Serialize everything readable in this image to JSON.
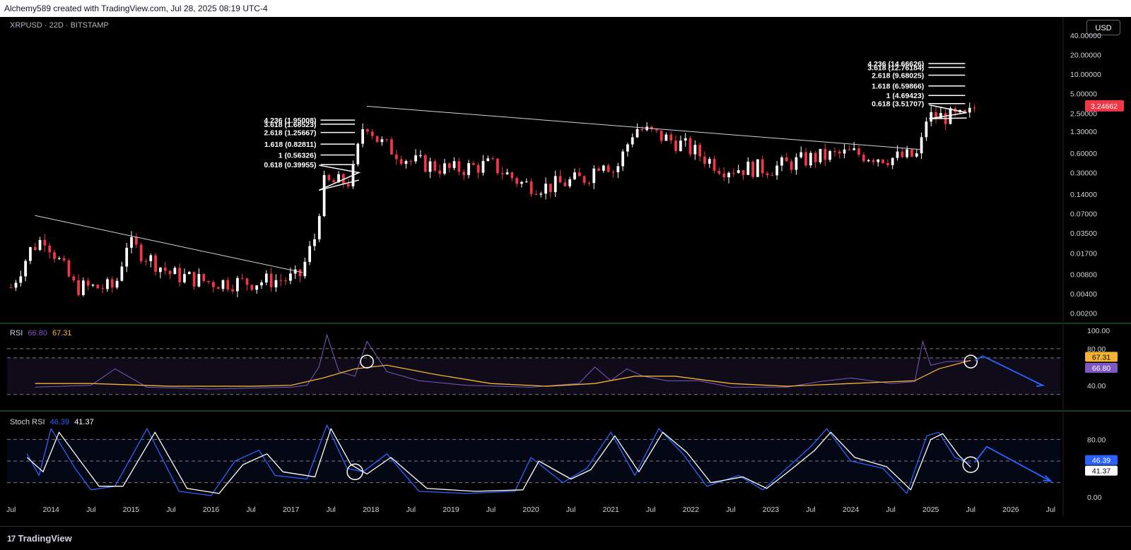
{
  "header": {
    "attribution": "Alchemy589 created with TradingView.com, Jul 28, 2025 08:19 UTC-4"
  },
  "symbol_line": "XRPUSD · 22D · BITSTAMP",
  "currency_button": "USD",
  "footer": {
    "brand": "TradingView",
    "brand_mark": "17"
  },
  "colors": {
    "up": "#ffffff",
    "down": "#f23645",
    "rsi": "#7e57c2",
    "rsi_ma": "#f5b335",
    "stoch_k": "#2962ff",
    "stoch_d": "#ffffff",
    "arrow": "#2962ff",
    "pane_border": "#2e7d32"
  },
  "chart_data": [
    {
      "type": "candlestick",
      "pane": "price",
      "scale": "log",
      "y_ticks": [
        "40.00000",
        "20.00000",
        "10.00000",
        "5.00000",
        "2.50000",
        "1.30000",
        "0.60000",
        "0.30000",
        "0.14000",
        "0.07000",
        "0.03500",
        "0.01700",
        "0.00800",
        "0.00400",
        "0.00200"
      ],
      "x_ticks": [
        "Jul",
        "2014",
        "Jul",
        "2015",
        "Jul",
        "2016",
        "Jul",
        "2017",
        "Jul",
        "2018",
        "Jul",
        "2019",
        "Jul",
        "2020",
        "Jul",
        "2021",
        "Jul",
        "2022",
        "Jul",
        "2023",
        "Jul",
        "2024",
        "Jul",
        "2025",
        "Jul",
        "2026",
        "Jul"
      ],
      "last_price": "3.24662",
      "ohlc_anchors": [
        {
          "t": 2013.5,
          "close": 0.005
        },
        {
          "t": 2013.75,
          "close": 0.02
        },
        {
          "t": 2013.92,
          "close": 0.03
        },
        {
          "t": 2014.3,
          "close": 0.005
        },
        {
          "t": 2014.8,
          "close": 0.005
        },
        {
          "t": 2014.95,
          "close": 0.025
        },
        {
          "t": 2015.5,
          "close": 0.008
        },
        {
          "t": 2016.0,
          "close": 0.006
        },
        {
          "t": 2016.5,
          "close": 0.006
        },
        {
          "t": 2017.1,
          "close": 0.007
        },
        {
          "t": 2017.3,
          "close": 0.03
        },
        {
          "t": 2017.4,
          "close": 0.2
        },
        {
          "t": 2017.75,
          "close": 0.22
        },
        {
          "t": 2017.92,
          "close": 2.0
        },
        {
          "t": 2018.1,
          "close": 0.9
        },
        {
          "t": 2018.5,
          "close": 0.45
        },
        {
          "t": 2019.0,
          "close": 0.33
        },
        {
          "t": 2019.5,
          "close": 0.4
        },
        {
          "t": 2019.9,
          "close": 0.2
        },
        {
          "t": 2020.2,
          "close": 0.18
        },
        {
          "t": 2020.7,
          "close": 0.25
        },
        {
          "t": 2020.9,
          "close": 0.5
        },
        {
          "t": 2021.05,
          "close": 0.3
        },
        {
          "t": 2021.3,
          "close": 1.5
        },
        {
          "t": 2021.7,
          "close": 1.0
        },
        {
          "t": 2021.9,
          "close": 0.8
        },
        {
          "t": 2022.4,
          "close": 0.35
        },
        {
          "t": 2023.0,
          "close": 0.35
        },
        {
          "t": 2023.5,
          "close": 0.5
        },
        {
          "t": 2024.0,
          "close": 0.6
        },
        {
          "t": 2024.5,
          "close": 0.5
        },
        {
          "t": 2024.85,
          "close": 0.55
        },
        {
          "t": 2024.95,
          "close": 2.2
        },
        {
          "t": 2025.2,
          "close": 2.2
        },
        {
          "t": 2025.45,
          "close": 2.1
        },
        {
          "t": 2025.56,
          "close": 3.24662
        }
      ],
      "fib_groups": [
        {
          "levels": [
            "4.236 (1.95008)",
            "3.618 (1.68523)",
            "2.618 (1.25667)",
            "1.618 (0.82811)",
            "1 (0.56326)",
            "0.618 (0.39955)"
          ]
        },
        {
          "levels": [
            "4.236 (14.66626)",
            "3.618 (12.76184)",
            "2.618 (9.68025)",
            "1.618 (6.59866)",
            "1 (4.69423)",
            "0.618 (3.51707)"
          ]
        }
      ]
    },
    {
      "type": "line",
      "pane": "RSI",
      "title": "RSI",
      "values_shown": [
        "66.80",
        "67.31"
      ],
      "y_ticks": [
        "100.00",
        "80.00",
        "60.00",
        "40.00"
      ],
      "bands": [
        80,
        70,
        30
      ],
      "series": [
        {
          "name": "RSI",
          "color": "#7e57c2",
          "x": [
            2013.8,
            2014.5,
            2014.8,
            2015.2,
            2016.0,
            2017.0,
            2017.2,
            2017.35,
            2017.45,
            2017.6,
            2017.8,
            2017.95,
            2018.2,
            2018.6,
            2019.2,
            2020.0,
            2020.6,
            2020.8,
            2021.0,
            2021.2,
            2021.4,
            2021.7,
            2022.1,
            2022.5,
            2023.2,
            2023.6,
            2024.0,
            2024.5,
            2024.8,
            2024.9,
            2025.0,
            2025.2,
            2025.5
          ],
          "y": [
            38,
            40,
            58,
            38,
            36,
            38,
            40,
            60,
            95,
            55,
            50,
            88,
            55,
            45,
            40,
            38,
            42,
            60,
            45,
            58,
            50,
            45,
            45,
            38,
            38,
            44,
            48,
            42,
            44,
            88,
            62,
            66,
            66.8
          ]
        },
        {
          "name": "RSI MA",
          "color": "#f5b335",
          "x": [
            2013.8,
            2014.5,
            2015.5,
            2016.5,
            2017.0,
            2017.4,
            2017.8,
            2018.2,
            2018.8,
            2019.5,
            2020.2,
            2020.8,
            2021.3,
            2021.8,
            2022.5,
            2023.2,
            2024.0,
            2024.8,
            2025.1,
            2025.5
          ],
          "y": [
            42,
            42,
            39,
            39,
            40,
            48,
            58,
            62,
            52,
            42,
            39,
            42,
            50,
            50,
            42,
            39,
            42,
            45,
            58,
            67.31
          ]
        }
      ]
    },
    {
      "type": "line",
      "pane": "Stoch RSI",
      "title": "Stoch RSI",
      "values_shown": [
        "46.39",
        "41.37"
      ],
      "y_ticks": [
        "80.00",
        "0.00"
      ],
      "bands": [
        80,
        50,
        20
      ],
      "series": [
        {
          "name": "K",
          "color": "#2962ff",
          "x": [
            2013.7,
            2013.85,
            2014.0,
            2014.3,
            2014.5,
            2014.8,
            2015.2,
            2015.6,
            2016.0,
            2016.3,
            2016.6,
            2016.8,
            2017.2,
            2017.45,
            2017.7,
            2017.9,
            2018.2,
            2018.6,
            2019.2,
            2019.8,
            2020.0,
            2020.4,
            2020.7,
            2021.0,
            2021.3,
            2021.6,
            2021.9,
            2022.2,
            2022.6,
            2022.9,
            2023.2,
            2023.5,
            2023.7,
            2024.0,
            2024.4,
            2024.7,
            2024.95,
            2025.1,
            2025.3,
            2025.5
          ],
          "y": [
            60,
            30,
            95,
            40,
            10,
            15,
            95,
            8,
            2,
            50,
            65,
            30,
            25,
            100,
            40,
            35,
            60,
            8,
            5,
            8,
            55,
            20,
            40,
            90,
            30,
            95,
            60,
            15,
            30,
            10,
            40,
            70,
            95,
            50,
            40,
            5,
            85,
            90,
            55,
            46.39
          ]
        },
        {
          "name": "D",
          "color": "#ffffff",
          "x": [
            2013.7,
            2013.9,
            2014.1,
            2014.4,
            2014.6,
            2014.9,
            2015.3,
            2015.7,
            2016.1,
            2016.4,
            2016.7,
            2016.9,
            2017.3,
            2017.5,
            2017.75,
            2017.95,
            2018.25,
            2018.7,
            2019.3,
            2019.9,
            2020.1,
            2020.5,
            2020.75,
            2021.05,
            2021.35,
            2021.65,
            2021.95,
            2022.25,
            2022.65,
            2022.95,
            2023.25,
            2023.55,
            2023.75,
            2024.05,
            2024.45,
            2024.75,
            2025.0,
            2025.15,
            2025.35,
            2025.5
          ],
          "y": [
            55,
            35,
            90,
            45,
            15,
            15,
            90,
            12,
            5,
            45,
            60,
            35,
            28,
            95,
            45,
            32,
            55,
            12,
            8,
            10,
            50,
            25,
            38,
            85,
            35,
            90,
            62,
            20,
            28,
            12,
            38,
            65,
            90,
            55,
            42,
            10,
            80,
            88,
            58,
            41.37
          ]
        }
      ]
    }
  ]
}
